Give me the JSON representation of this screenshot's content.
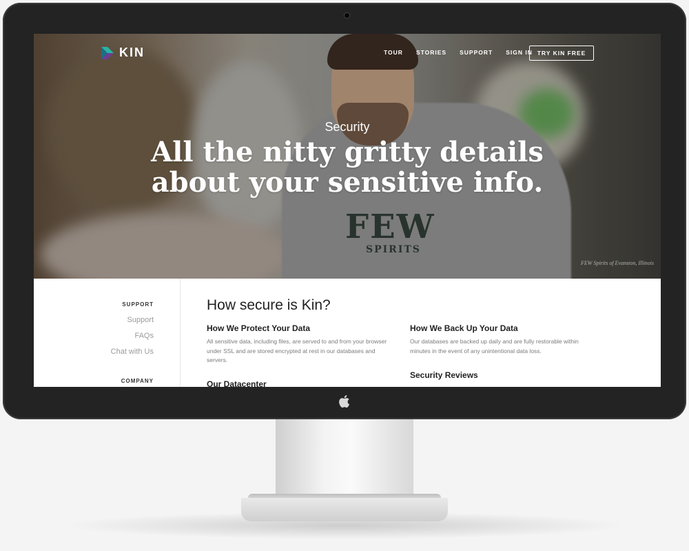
{
  "site": {
    "brand": "KIN",
    "nav": [
      "TOUR",
      "STORIES",
      "SUPPORT",
      "SIGN IN"
    ],
    "cta": "TRY KIN FREE"
  },
  "hero": {
    "kicker": "Security",
    "headline_line1": "All the nitty gritty details",
    "headline_line2": "about your sensitive info.",
    "photo_text_few": "FEW",
    "photo_text_spirits": "SPIRITS",
    "credit": "FEW Spirits of Evanston, Illinois"
  },
  "sidebar": {
    "support_heading": "SUPPORT",
    "links": [
      "Support",
      "FAQs",
      "Chat with Us"
    ],
    "company_heading": "COMPANY"
  },
  "content": {
    "title": "How secure is Kin?",
    "protect_title": "How We Protect Your Data",
    "protect_body": "All sensitive data, including files, are served to and from your browser under SSL and are stored encrypted at rest in our databases and servers.",
    "datacenter_title": "Our Datacenter",
    "backup_title": "How We Back Up Your Data",
    "backup_body": "Our databases are backed up daily and are fully restorable within minutes in the event of any unintentional data loss.",
    "reviews_title": "Security Reviews"
  },
  "colors": {
    "bezel": "#232323",
    "accent": "#2bb3a3",
    "text_dark": "#222222",
    "text_muted": "#7b7b7b"
  },
  "icons": [
    "camera-icon",
    "kin-logo-icon",
    "apple-logo-icon"
  ]
}
